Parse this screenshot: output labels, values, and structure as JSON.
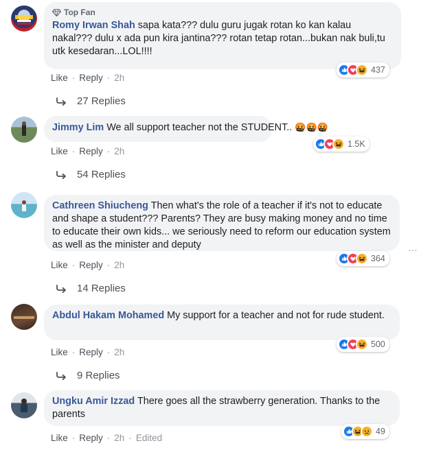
{
  "comments": [
    {
      "badge": "Top Fan",
      "name": "Romy Irwan Shah",
      "text": "sapa kata??? dulu guru jugak rotan ko kan kalau nakal??? dulu x ada pun kira jantina??? rotan tetap rotan...bukan nak buli,tu utk kesedaran...LOL!!!!",
      "like": "Like",
      "reply": "Reply",
      "time": "2h",
      "reactions": [
        "like",
        "love",
        "haha"
      ],
      "count": "437",
      "replies": "27 Replies"
    },
    {
      "name": "Jimmy Lim",
      "text": "We all support teacher not the STUDENT..",
      "emoji": "🤬🤬🤬",
      "like": "Like",
      "reply": "Reply",
      "time": "2h",
      "reactions": [
        "like",
        "love",
        "haha"
      ],
      "count": "1.5K",
      "replies": "54 Replies"
    },
    {
      "name": "Cathreen Shiucheng",
      "text": "Then what's the role of a teacher if it's not to educate and shape a student??? Parents? They are busy making money and no time to educate their own kids... we seriously need to reform our education system as well as the minister and deputy",
      "like": "Like",
      "reply": "Reply",
      "time": "2h",
      "reactions": [
        "like",
        "love",
        "haha"
      ],
      "count": "364",
      "replies": "14 Replies"
    },
    {
      "name": "Abdul Hakam Mohamed",
      "text": "My support for a teacher and not for rude student.",
      "like": "Like",
      "reply": "Reply",
      "time": "2h",
      "reactions": [
        "like",
        "love",
        "haha"
      ],
      "count": "500",
      "replies": "9 Replies"
    },
    {
      "name": "Ungku Amir Izzad",
      "text": "There goes all the strawberry generation. Thanks to the parents",
      "like": "Like",
      "reply": "Reply",
      "time": "2h",
      "edited": "Edited",
      "reactions": [
        "like",
        "haha",
        "sad"
      ],
      "count": "49"
    }
  ],
  "more_icon": "…",
  "colors": {
    "name": "#385898",
    "bubble": "#f2f3f5",
    "like": "#1877f2",
    "love": "#f33e58",
    "haha": "#f7b125"
  }
}
